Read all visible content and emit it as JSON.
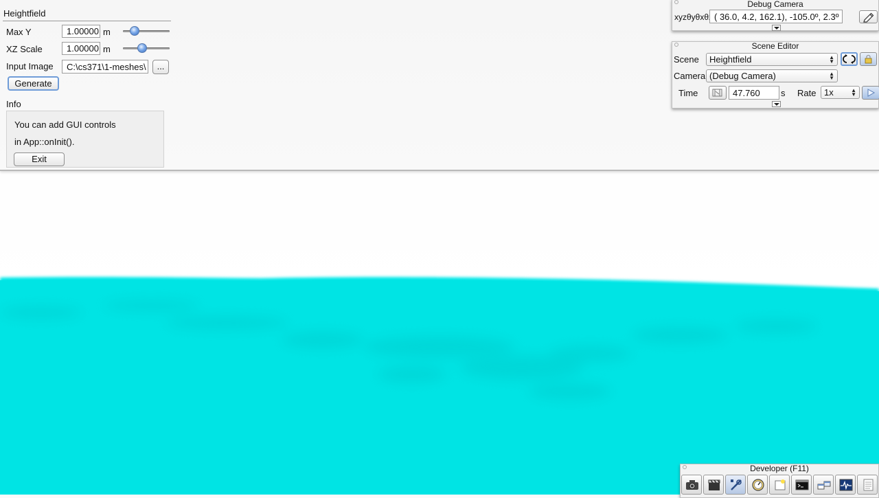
{
  "heightfield": {
    "title": "Heightfield",
    "max_y": {
      "label": "Max Y",
      "value": "1.00000",
      "unit": "m",
      "slider_fraction": 0.18
    },
    "xz_scale": {
      "label": "XZ Scale",
      "value": "1.00000",
      "unit": "m",
      "slider_fraction": 0.39
    },
    "input_image": {
      "label": "Input Image",
      "value": "C:\\cs371\\1-meshes\\",
      "browse_label": "..."
    },
    "generate_label": "Generate"
  },
  "info": {
    "title": "Info",
    "line1": "You can add GUI controls",
    "line2": "in App::onInit().",
    "exit_label": "Exit"
  },
  "debug_camera": {
    "title": "Debug Camera",
    "label": "xyzθyθxθz",
    "value": "( 36.0,   4.2,  162.1), -105.0º,   2.3º"
  },
  "scene_editor": {
    "title": "Scene Editor",
    "scene_label": "Scene",
    "scene_value": "Heightfield",
    "camera_label": "Camera",
    "camera_value": "(Debug Camera)",
    "time_label": "Time",
    "time_value": "47.760",
    "time_unit": "s",
    "rate_label": "Rate",
    "rate_value": "1x"
  },
  "developer": {
    "title": "Developer (F11)",
    "tools": [
      "camera-icon",
      "clapperboard-icon",
      "wrench-icon",
      "speedometer-icon",
      "new-window-icon",
      "console-icon",
      "scene-graph-icon",
      "profiler-icon",
      "notepad-icon"
    ]
  },
  "colors": {
    "terrain": "#00e5e5",
    "accent_blue": "#6f9cd8"
  }
}
